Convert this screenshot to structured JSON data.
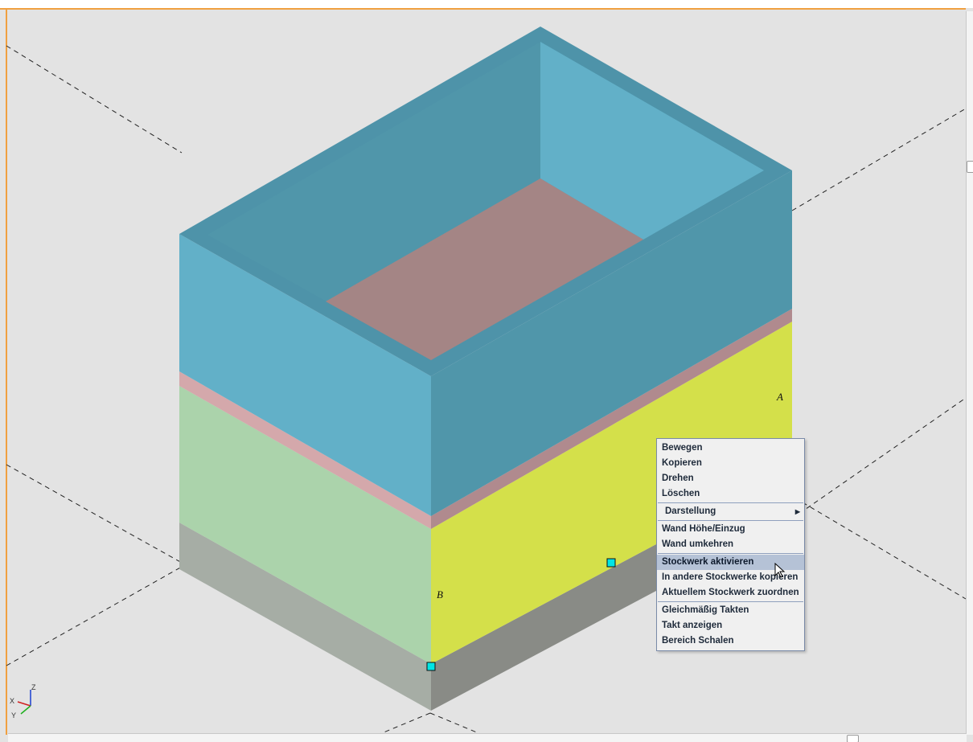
{
  "scene": {
    "wall_labels": {
      "wall_a": "A",
      "wall_b": "B"
    },
    "axis_gizmo": {
      "x_label": "X",
      "y_label": "Y",
      "z_label": "Z"
    },
    "colors": {
      "background": "#e3e3e3",
      "frame_border": "#f0a040",
      "upper_wall_front": "#62b0c8",
      "upper_wall_side": "#5096aa",
      "upper_wall_top": "#4e93a9",
      "floor_slab": "#a48585",
      "slab_band_front": "#d4a8ab",
      "slab_band_side": "#b08a8e",
      "lower_wall_front": "#abd3ab",
      "lower_wall_side": "#d4e04a",
      "base_front": "#a6ada5",
      "base_side": "#898b86",
      "grip_handle": "#00e5e5"
    }
  },
  "context_menu": {
    "items": [
      {
        "label": "Bewegen"
      },
      {
        "label": "Kopieren"
      },
      {
        "label": "Drehen"
      },
      {
        "label": "Löschen"
      },
      {
        "separator": true
      },
      {
        "label": "Darstellung",
        "submenu": true
      },
      {
        "separator": true
      },
      {
        "label": "Wand Höhe/Einzug"
      },
      {
        "label": "Wand umkehren"
      },
      {
        "separator": true
      },
      {
        "label": "Stockwerk aktivieren",
        "highlighted": true
      },
      {
        "label": "In andere Stockwerke kopieren"
      },
      {
        "label": "Aktuellem Stockwerk zuordnen"
      },
      {
        "separator": true
      },
      {
        "label": "Gleichmäßig Takten"
      },
      {
        "label": "Takt anzeigen"
      },
      {
        "label": "Bereich Schalen"
      }
    ]
  }
}
